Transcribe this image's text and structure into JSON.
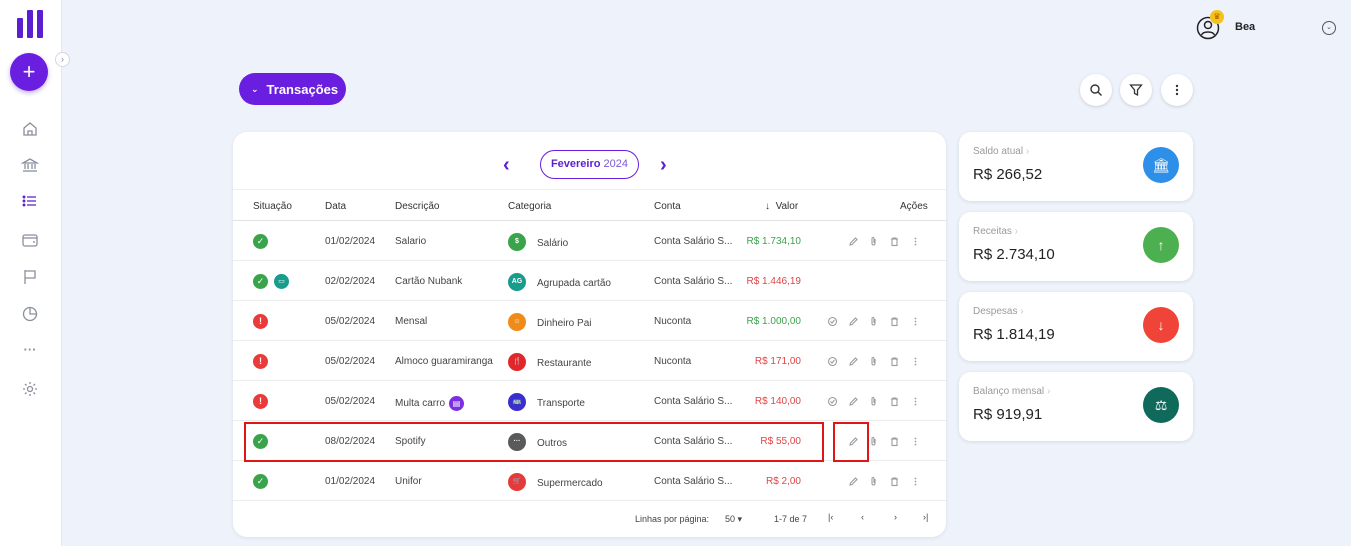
{
  "sidebar": {
    "collapse_icon": "chevron-right-icon",
    "add_label": "+",
    "nav": [
      "home-icon",
      "bank-icon",
      "list-icon",
      "wallet-icon",
      "flag-icon",
      "pie-chart-icon",
      "more-icon",
      "settings-icon"
    ],
    "more_label": "···"
  },
  "user": {
    "name": "Bea",
    "menu_icon": "chevron-down-circle-icon"
  },
  "header": {
    "title": "Transações",
    "search_icon": "search-icon",
    "filter_icon": "filter-icon",
    "menu_icon": "kebab-menu-icon"
  },
  "month_nav": {
    "month": "Fevereiro",
    "year": "2024",
    "prev": "‹",
    "next": "›"
  },
  "table": {
    "columns": {
      "status": "Situação",
      "date": "Data",
      "description": "Descrição",
      "category": "Categoria",
      "account": "Conta",
      "value": "Valor",
      "actions": "Ações"
    },
    "rows": [
      {
        "status": "ok",
        "date": "01/02/2024",
        "description": "Salario",
        "category": "Salário",
        "cat_color": "#3aa44a",
        "cat_glyph": "$",
        "account": "Conta Salário S...",
        "value": "R$ 1.734,10",
        "value_type": "pos",
        "confirm": false
      },
      {
        "status": "ok",
        "date": "02/02/2024",
        "description": "Cartão Nubank",
        "category": "Agrupada cartão",
        "cat_color": "#189c8c",
        "cat_glyph": "AG",
        "account": "Conta Salário S...",
        "value": "R$ 1.446,19",
        "value_type": "neg",
        "confirm": false,
        "card_badge": true,
        "no_actions": true
      },
      {
        "status": "warn",
        "date": "05/02/2024",
        "description": "Mensal",
        "category": "Dinheiro Pai",
        "cat_color": "#f08a18",
        "cat_glyph": "☺",
        "account": "Nuconta",
        "value": "R$ 1.000,00",
        "value_type": "pos",
        "confirm": true
      },
      {
        "status": "warn",
        "date": "05/02/2024",
        "description": "Almoco guaramiranga",
        "category": "Restaurante",
        "cat_color": "#e0282a",
        "cat_glyph": "🍴",
        "account": "Nuconta",
        "value": "R$ 171,00",
        "value_type": "neg",
        "confirm": true
      },
      {
        "status": "warn",
        "date": "05/02/2024",
        "description": "Multa carro",
        "category": "Transporte",
        "cat_color": "#3a2ed0",
        "cat_glyph": "🚌",
        "account": "Conta Salário S...",
        "value": "R$ 140,00",
        "value_type": "neg",
        "confirm": true,
        "desc_badge": true
      },
      {
        "status": "ok",
        "date": "08/02/2024",
        "description": "Spotify",
        "category": "Outros",
        "cat_color": "#5a5a5a",
        "cat_glyph": "···",
        "account": "Conta Salário S...",
        "value": "R$ 55,00",
        "value_type": "neg",
        "confirm": false
      },
      {
        "status": "ok",
        "date": "01/02/2024",
        "description": "Unifor",
        "category": "Supermercado",
        "cat_color": "#e63a3a",
        "cat_glyph": "🛒",
        "account": "Conta Salário S...",
        "value": "R$ 2,00",
        "value_type": "neg",
        "confirm": false
      }
    ]
  },
  "pagination": {
    "rows_label": "Linhas por página:",
    "rows_value": "50 ▾",
    "range": "1-7 de 7",
    "first": "|‹",
    "prev": "‹",
    "next": "›",
    "last": "›|"
  },
  "summary": [
    {
      "label": "Saldo atual",
      "value": "R$ 266,52",
      "color": "#2d8fe8",
      "icon": "bank-icon",
      "glyph": "🏛"
    },
    {
      "label": "Receitas",
      "value": "R$ 2.734,10",
      "color": "#4caf50",
      "icon": "arrow-up-icon",
      "glyph": "↑"
    },
    {
      "label": "Despesas",
      "value": "R$ 1.814,19",
      "color": "#f04438",
      "icon": "arrow-down-icon",
      "glyph": "↓"
    },
    {
      "label": "Balanço mensal",
      "value": "R$ 919,91",
      "color": "#0f6a5c",
      "icon": "scale-icon",
      "glyph": "⚖"
    }
  ]
}
